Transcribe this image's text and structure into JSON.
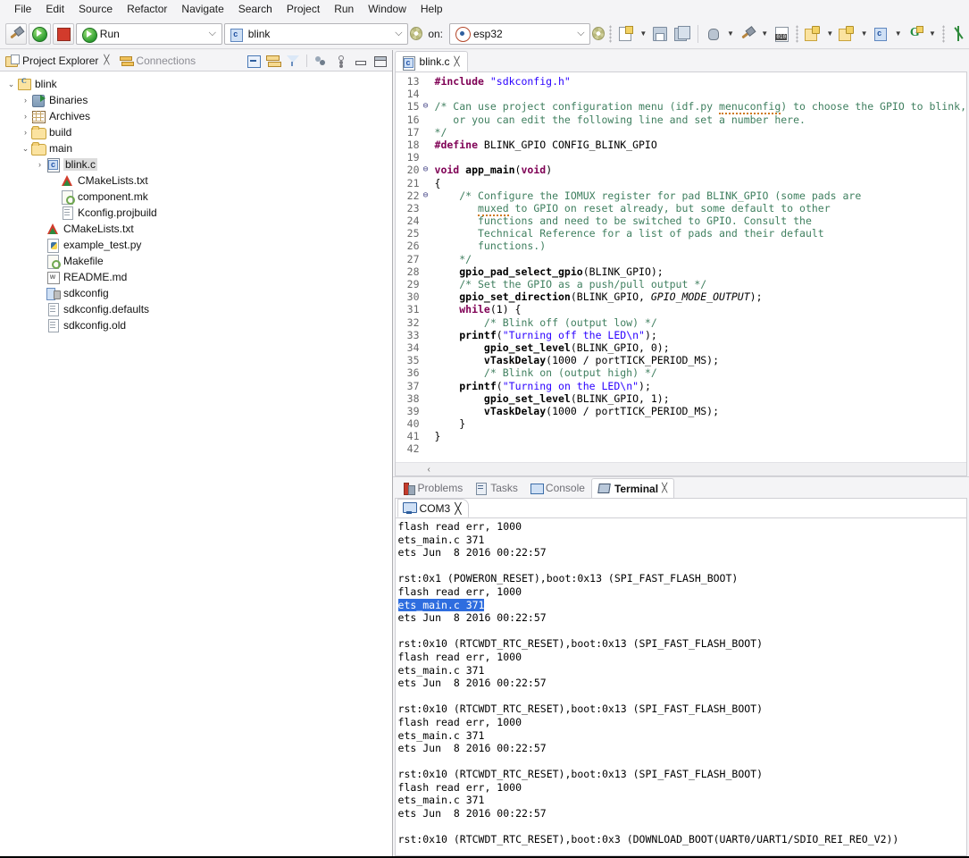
{
  "menubar": {
    "items": [
      "File",
      "Edit",
      "Source",
      "Refactor",
      "Navigate",
      "Search",
      "Project",
      "Run",
      "Window",
      "Help"
    ]
  },
  "toolbar": {
    "build_icon": "hammer-icon",
    "run_icon": "run-icon",
    "stop_icon": "stop-icon",
    "launch_mode": "Run",
    "project_value": "blink",
    "on_label": "on:",
    "target_value": "esp32",
    "gear_icon": "gear-icon",
    "icons": [
      "new-file-icon",
      "save-icon",
      "save-all-icon",
      "debug-icon",
      "build-icon",
      "binary-icon",
      "new-c-project-icon",
      "new-c-folder-icon",
      "new-c-class-icon",
      "git-icon",
      "asterisk-icon"
    ]
  },
  "explorer": {
    "tabs": [
      {
        "label": "Project Explorer",
        "icon": "project-explorer-icon",
        "active": true,
        "close": "╳"
      },
      {
        "label": "Connections",
        "icon": "connections-icon",
        "active": false
      }
    ],
    "toolbar_icons": [
      "collapse-all-icon",
      "link-with-editor-icon",
      "filter-icon",
      "view-menu-icon",
      "more-icon",
      "minimize-icon",
      "maximize-icon"
    ],
    "tree": [
      {
        "label": "blink",
        "icon": "c-project-icon",
        "depth": 0,
        "arrow": "⌄",
        "selected": false
      },
      {
        "label": "Binaries",
        "icon": "binaries-icon",
        "depth": 1,
        "arrow": "›",
        "selected": false
      },
      {
        "label": "Archives",
        "icon": "archives-icon",
        "depth": 1,
        "arrow": "›",
        "selected": false
      },
      {
        "label": "build",
        "icon": "folder-icon",
        "depth": 1,
        "arrow": "›",
        "selected": false
      },
      {
        "label": "main",
        "icon": "folder-icon",
        "depth": 1,
        "arrow": "⌄",
        "selected": false
      },
      {
        "label": "blink.c",
        "icon": "c-file-icon",
        "depth": 2,
        "arrow": "›",
        "selected": true
      },
      {
        "label": "CMakeLists.txt",
        "icon": "cmake-icon",
        "depth": 3,
        "arrow": "",
        "selected": false
      },
      {
        "label": "component.mk",
        "icon": "makefile-icon",
        "depth": 3,
        "arrow": "",
        "selected": false
      },
      {
        "label": "Kconfig.projbuild",
        "icon": "text-file-icon",
        "depth": 3,
        "arrow": "",
        "selected": false
      },
      {
        "label": "CMakeLists.txt",
        "icon": "cmake-icon",
        "depth": 2,
        "arrow": "",
        "selected": false
      },
      {
        "label": "example_test.py",
        "icon": "python-file-icon",
        "depth": 2,
        "arrow": "",
        "selected": false
      },
      {
        "label": "Makefile",
        "icon": "makefile-icon",
        "depth": 2,
        "arrow": "",
        "selected": false
      },
      {
        "label": "README.md",
        "icon": "markdown-file-icon",
        "depth": 2,
        "arrow": "",
        "selected": false
      },
      {
        "label": "sdkconfig",
        "icon": "config-file-icon",
        "depth": 2,
        "arrow": "",
        "selected": false
      },
      {
        "label": "sdkconfig.defaults",
        "icon": "text-file-icon",
        "depth": 2,
        "arrow": "",
        "selected": false
      },
      {
        "label": "sdkconfig.old",
        "icon": "text-file-icon",
        "depth": 2,
        "arrow": "",
        "selected": false
      }
    ]
  },
  "editor": {
    "tab": {
      "label": "blink.c",
      "icon": "c-file-icon",
      "close": "╳"
    },
    "lines": [
      {
        "n": "13",
        "fold": "",
        "tokens": [
          {
            "t": "#include ",
            "c": "pp"
          },
          {
            "t": "\"sdkconfig.h\"",
            "c": "str"
          }
        ]
      },
      {
        "n": "14",
        "fold": "",
        "tokens": []
      },
      {
        "n": "15",
        "fold": "⊖",
        "tokens": [
          {
            "t": "/* Can use project configuration menu (idf.py ",
            "c": "cmt"
          },
          {
            "t": "menuconfig",
            "c": "cmt spell"
          },
          {
            "t": ") to choose the GPIO to blink,",
            "c": "cmt"
          }
        ]
      },
      {
        "n": "16",
        "fold": "",
        "tokens": [
          {
            "t": "   or you can edit the following line and set a number here.",
            "c": "cmt"
          }
        ]
      },
      {
        "n": "17",
        "fold": "",
        "tokens": [
          {
            "t": "*/",
            "c": "cmt"
          }
        ]
      },
      {
        "n": "18",
        "fold": "",
        "tokens": [
          {
            "t": "#define ",
            "c": "pp"
          },
          {
            "t": "BLINK_GPIO CONFIG_BLINK_GPIO",
            "c": "plain"
          }
        ]
      },
      {
        "n": "19",
        "fold": "",
        "tokens": []
      },
      {
        "n": "20",
        "fold": "⊖",
        "tokens": [
          {
            "t": "void ",
            "c": "kw"
          },
          {
            "t": "app_main",
            "c": "fn"
          },
          {
            "t": "(",
            "c": "plain"
          },
          {
            "t": "void",
            "c": "kw"
          },
          {
            "t": ")",
            "c": "plain"
          }
        ]
      },
      {
        "n": "21",
        "fold": "",
        "tokens": [
          {
            "t": "{",
            "c": "plain"
          }
        ]
      },
      {
        "n": "22",
        "fold": "⊖",
        "tokens": [
          {
            "t": "    /* Configure the IOMUX register for pad BLINK_GPIO (some pads are",
            "c": "cmt"
          }
        ]
      },
      {
        "n": "23",
        "fold": "",
        "tokens": [
          {
            "t": "       ",
            "c": "cmt"
          },
          {
            "t": "muxed",
            "c": "cmt spell"
          },
          {
            "t": " to GPIO on reset already, but some default to other",
            "c": "cmt"
          }
        ]
      },
      {
        "n": "24",
        "fold": "",
        "tokens": [
          {
            "t": "       functions and need to be switched to GPIO. Consult the",
            "c": "cmt"
          }
        ]
      },
      {
        "n": "25",
        "fold": "",
        "tokens": [
          {
            "t": "       Technical Reference for a list of pads and their default",
            "c": "cmt"
          }
        ]
      },
      {
        "n": "26",
        "fold": "",
        "tokens": [
          {
            "t": "       functions.)",
            "c": "cmt"
          }
        ]
      },
      {
        "n": "27",
        "fold": "",
        "tokens": [
          {
            "t": "    */",
            "c": "cmt"
          }
        ]
      },
      {
        "n": "28",
        "fold": "",
        "tokens": [
          {
            "t": "    ",
            "c": "plain"
          },
          {
            "t": "gpio_pad_select_gpio",
            "c": "fn"
          },
          {
            "t": "(BLINK_GPIO);",
            "c": "plain"
          }
        ]
      },
      {
        "n": "29",
        "fold": "",
        "tokens": [
          {
            "t": "    /* Set the GPIO as a push/pull output */",
            "c": "cmt"
          }
        ]
      },
      {
        "n": "30",
        "fold": "",
        "tokens": [
          {
            "t": "    ",
            "c": "plain"
          },
          {
            "t": "gpio_set_direction",
            "c": "fn"
          },
          {
            "t": "(BLINK_GPIO, ",
            "c": "plain"
          },
          {
            "t": "GPIO_MODE_OUTPUT",
            "c": "macro"
          },
          {
            "t": ");",
            "c": "plain"
          }
        ]
      },
      {
        "n": "31",
        "fold": "",
        "tokens": [
          {
            "t": "    ",
            "c": "plain"
          },
          {
            "t": "while",
            "c": "kw"
          },
          {
            "t": "(1) {",
            "c": "plain"
          }
        ]
      },
      {
        "n": "32",
        "fold": "",
        "tokens": [
          {
            "t": "        /* Blink off (output low) */",
            "c": "cmt"
          }
        ]
      },
      {
        "n": "33",
        "fold": "",
        "tokens": [
          {
            "t": "    ",
            "c": "plain"
          },
          {
            "t": "printf",
            "c": "fn"
          },
          {
            "t": "(",
            "c": "plain"
          },
          {
            "t": "\"Turning off the LED\\n\"",
            "c": "str"
          },
          {
            "t": ");",
            "c": "plain"
          }
        ]
      },
      {
        "n": "34",
        "fold": "",
        "tokens": [
          {
            "t": "        ",
            "c": "plain"
          },
          {
            "t": "gpio_set_level",
            "c": "fn"
          },
          {
            "t": "(BLINK_GPIO, 0);",
            "c": "plain"
          }
        ]
      },
      {
        "n": "35",
        "fold": "",
        "tokens": [
          {
            "t": "        ",
            "c": "plain"
          },
          {
            "t": "vTaskDelay",
            "c": "fn"
          },
          {
            "t": "(1000 / portTICK_PERIOD_MS);",
            "c": "plain"
          }
        ]
      },
      {
        "n": "36",
        "fold": "",
        "tokens": [
          {
            "t": "        /* Blink on (output high) */",
            "c": "cmt"
          }
        ]
      },
      {
        "n": "37",
        "fold": "",
        "tokens": [
          {
            "t": "    ",
            "c": "plain"
          },
          {
            "t": "printf",
            "c": "fn"
          },
          {
            "t": "(",
            "c": "plain"
          },
          {
            "t": "\"Turning on the LED\\n\"",
            "c": "str"
          },
          {
            "t": ");",
            "c": "plain"
          }
        ]
      },
      {
        "n": "38",
        "fold": "",
        "tokens": [
          {
            "t": "        ",
            "c": "plain"
          },
          {
            "t": "gpio_set_level",
            "c": "fn"
          },
          {
            "t": "(BLINK_GPIO, 1);",
            "c": "plain"
          }
        ]
      },
      {
        "n": "39",
        "fold": "",
        "tokens": [
          {
            "t": "        ",
            "c": "plain"
          },
          {
            "t": "vTaskDelay",
            "c": "fn"
          },
          {
            "t": "(1000 / portTICK_PERIOD_MS);",
            "c": "plain"
          }
        ]
      },
      {
        "n": "40",
        "fold": "",
        "tokens": [
          {
            "t": "    }",
            "c": "plain"
          }
        ]
      },
      {
        "n": "41",
        "fold": "",
        "tokens": [
          {
            "t": "}",
            "c": "plain"
          }
        ]
      },
      {
        "n": "42",
        "fold": "",
        "tokens": []
      }
    ],
    "hscroll_left_arrow": "‹"
  },
  "bottom_panel": {
    "tabs": [
      {
        "label": "Problems",
        "icon": "problems-icon",
        "active": false
      },
      {
        "label": "Tasks",
        "icon": "tasks-icon",
        "active": false
      },
      {
        "label": "Console",
        "icon": "console-icon",
        "active": false
      },
      {
        "label": "Terminal",
        "icon": "terminal-icon",
        "active": true,
        "close": "╳"
      }
    ],
    "console_tab": {
      "label": "COM3",
      "icon": "monitor-icon",
      "close": "╳"
    },
    "output": [
      {
        "text": "flash read err, 1000",
        "selected": false
      },
      {
        "text": "ets_main.c 371",
        "selected": false
      },
      {
        "text": "ets Jun  8 2016 00:22:57",
        "selected": false
      },
      {
        "text": "",
        "selected": false
      },
      {
        "text": "rst:0x1 (POWERON_RESET),boot:0x13 (SPI_FAST_FLASH_BOOT)",
        "selected": false
      },
      {
        "text": "flash read err, 1000",
        "selected": false
      },
      {
        "text": "ets_main.c 371",
        "selected": true
      },
      {
        "text": "ets Jun  8 2016 00:22:57",
        "selected": false
      },
      {
        "text": "",
        "selected": false
      },
      {
        "text": "rst:0x10 (RTCWDT_RTC_RESET),boot:0x13 (SPI_FAST_FLASH_BOOT)",
        "selected": false
      },
      {
        "text": "flash read err, 1000",
        "selected": false
      },
      {
        "text": "ets_main.c 371",
        "selected": false
      },
      {
        "text": "ets Jun  8 2016 00:22:57",
        "selected": false
      },
      {
        "text": "",
        "selected": false
      },
      {
        "text": "rst:0x10 (RTCWDT_RTC_RESET),boot:0x13 (SPI_FAST_FLASH_BOOT)",
        "selected": false
      },
      {
        "text": "flash read err, 1000",
        "selected": false
      },
      {
        "text": "ets_main.c 371",
        "selected": false
      },
      {
        "text": "ets Jun  8 2016 00:22:57",
        "selected": false
      },
      {
        "text": "",
        "selected": false
      },
      {
        "text": "rst:0x10 (RTCWDT_RTC_RESET),boot:0x13 (SPI_FAST_FLASH_BOOT)",
        "selected": false
      },
      {
        "text": "flash read err, 1000",
        "selected": false
      },
      {
        "text": "ets_main.c 371",
        "selected": false
      },
      {
        "text": "ets Jun  8 2016 00:22:57",
        "selected": false
      },
      {
        "text": "",
        "selected": false
      },
      {
        "text": "rst:0x10 (RTCWDT_RTC_RESET),boot:0x3 (DOWNLOAD_BOOT(UART0/UART1/SDIO_REI_REO_V2))",
        "selected": false
      }
    ]
  },
  "colors": {
    "chrome": "#f4f4f6",
    "selection_blue": "#2e6ddf",
    "keyword_purple": "#7f0055",
    "comment_green": "#3f7f5f",
    "string_blue": "#2a00ff",
    "tree_selection_gray": "#dcdcdc"
  }
}
